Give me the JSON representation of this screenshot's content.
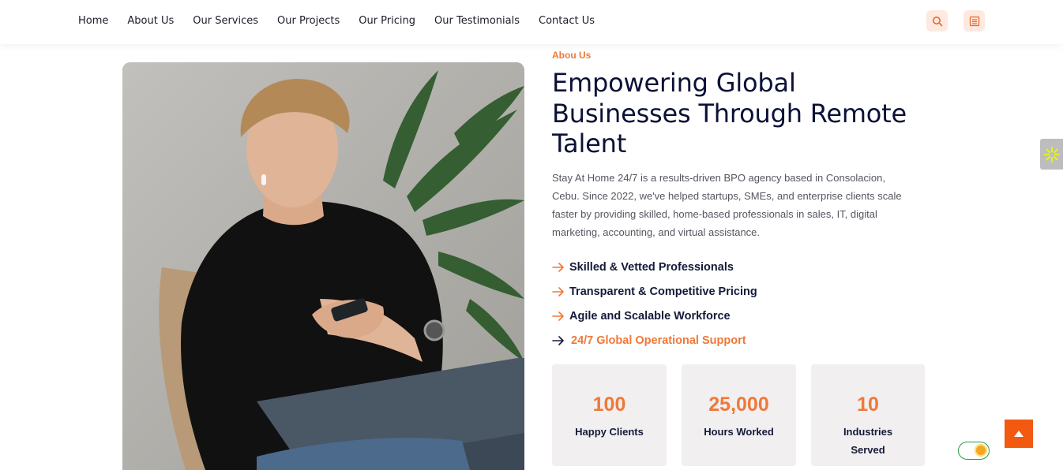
{
  "nav": {
    "items": [
      {
        "label": "Home"
      },
      {
        "label": "About Us"
      },
      {
        "label": "Our Services"
      },
      {
        "label": "Our Projects"
      },
      {
        "label": "Our Pricing"
      },
      {
        "label": "Our Testimonials"
      },
      {
        "label": "Contact Us"
      }
    ],
    "icons": [
      "search-icon",
      "document-icon"
    ]
  },
  "about": {
    "eyebrow": "Abou Us",
    "title": "Empowering Global Businesses Through Remote Talent",
    "description": "Stay At Home 24/7 is a results-driven BPO agency based in Consolacion, Cebu. Since 2022, we've helped startups, SMEs, and enterprise clients scale faster by providing skilled, home-based professionals in sales, IT, digital marketing, accounting, and virtual assistance.",
    "features": [
      {
        "label": "Skilled & Vetted Professionals"
      },
      {
        "label": "Transparent & Competitive Pricing"
      },
      {
        "label": "Agile and Scalable Workforce"
      },
      {
        "label": "24/7 Global Operational Support"
      }
    ]
  },
  "stats": [
    {
      "number": "100",
      "label": "Happy Clients"
    },
    {
      "number": "25,000",
      "label": "Hours Worked"
    },
    {
      "number": "10",
      "label": "Industries Served"
    }
  ],
  "colors": {
    "accent": "#f07838",
    "heading": "#0b1136",
    "scroll_button": "#f25a12"
  }
}
